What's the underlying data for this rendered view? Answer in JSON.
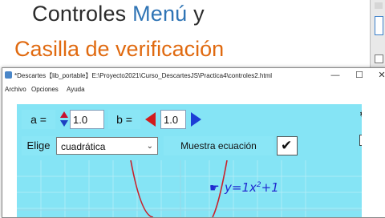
{
  "slide": {
    "title_line1_a": "Controles ",
    "title_line1_b": "Menú",
    "title_line1_c": " y",
    "title_line2": "Casilla de verificación"
  },
  "window": {
    "title": "*Descartes【lib_portable】E:\\Proyecto2021\\Curso_DescartesJS\\Practica4\\controles2.html",
    "minimize": "—",
    "maximize": "☐",
    "close": "✕"
  },
  "menu": [
    "Archivo",
    "Opciones",
    "Ayuda"
  ],
  "controls": {
    "a_label": "a =",
    "a_value": "1.0",
    "b_label": "b =",
    "b_value": "1.0",
    "elige_label": "Elige",
    "select_value": "cuadrática",
    "show_equation_label": "Muestra ecuación",
    "checkbox_checked": true,
    "checkmark": "✔"
  },
  "equation": {
    "prefix": "y=1x",
    "exponent": "2",
    "suffix": "+1",
    "pointer": "☛"
  },
  "sidebar": {
    "settings_icon": "gear-icon",
    "settings_glyph": "⚙",
    "code_icon": "code-icon",
    "code_glyph": "<>"
  },
  "colors": {
    "scene_bg": "#85e4f5",
    "title_blue": "#2f74b5",
    "title_orange": "#e06a10",
    "equation_blue": "#1f2ad0",
    "curve_red": "#c8202a"
  }
}
